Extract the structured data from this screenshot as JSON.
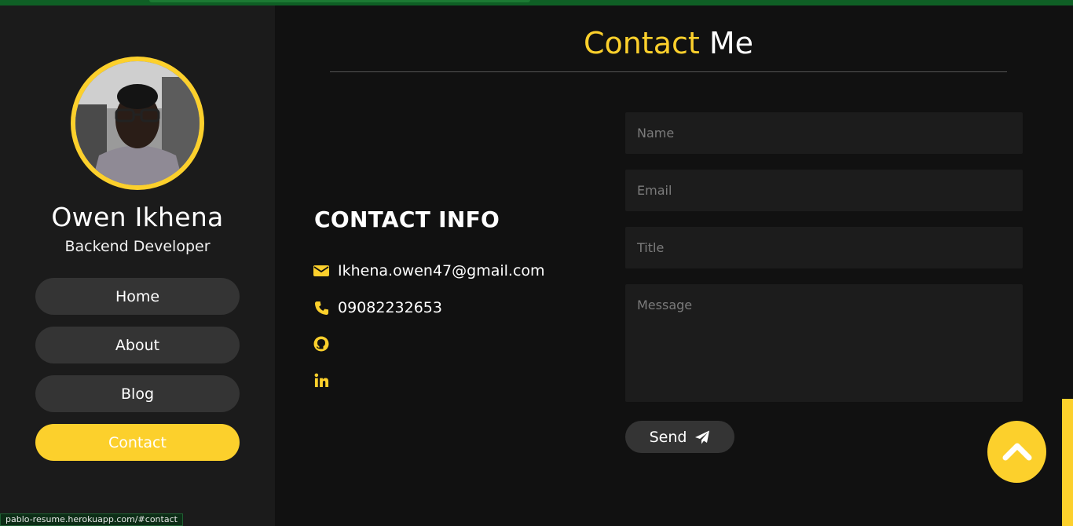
{
  "profile": {
    "name": "Owen Ikhena",
    "role": "Backend Developer"
  },
  "nav": {
    "items": [
      {
        "label": "Home",
        "active": false
      },
      {
        "label": "About",
        "active": false
      },
      {
        "label": "Blog",
        "active": false
      },
      {
        "label": "Contact",
        "active": true
      }
    ]
  },
  "section": {
    "title_accent": "Contact",
    "title_rest": "Me"
  },
  "contact_info": {
    "heading": "CONTACT INFO",
    "email": "Ikhena.owen47@gmail.com",
    "phone": "09082232653",
    "icons": [
      "envelope-icon",
      "phone-icon",
      "github-icon",
      "linkedin-icon"
    ]
  },
  "form": {
    "name_placeholder": "Name",
    "email_placeholder": "Email",
    "title_placeholder": "Title",
    "message_placeholder": "Message",
    "send_label": "Send"
  },
  "status_bar": {
    "url": "pablo-resume.herokuapp.com/#contact"
  },
  "colors": {
    "accent": "#fcd02c",
    "sidebar_bg": "#1b1b1b",
    "main_bg": "#111111",
    "button_bg": "#343434"
  }
}
